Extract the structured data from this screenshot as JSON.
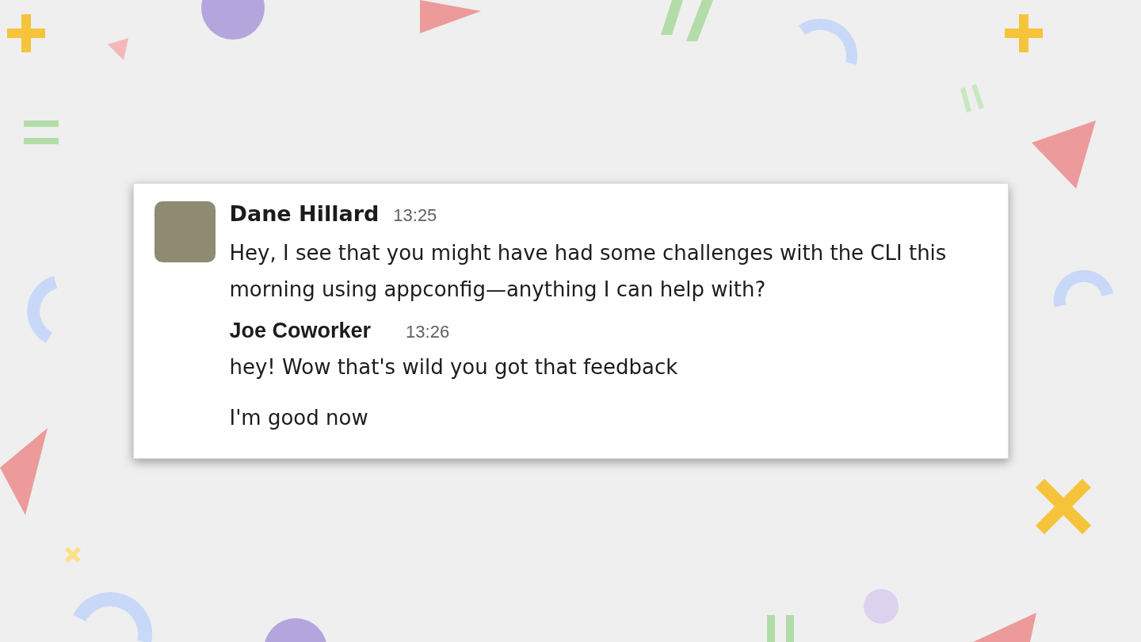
{
  "messages": [
    {
      "kind": "with-avatar",
      "author": "Dane Hillard",
      "time": "13:25",
      "paragraphs": [
        "Hey, I see that you might have had some challenges with the CLI this morning using appconfig—anything I can help with?"
      ]
    },
    {
      "kind": "compact",
      "author": "Joe Coworker",
      "time": "13:26",
      "paragraphs": [
        "hey! Wow that's wild you got that feedback",
        "I'm good now"
      ]
    }
  ]
}
